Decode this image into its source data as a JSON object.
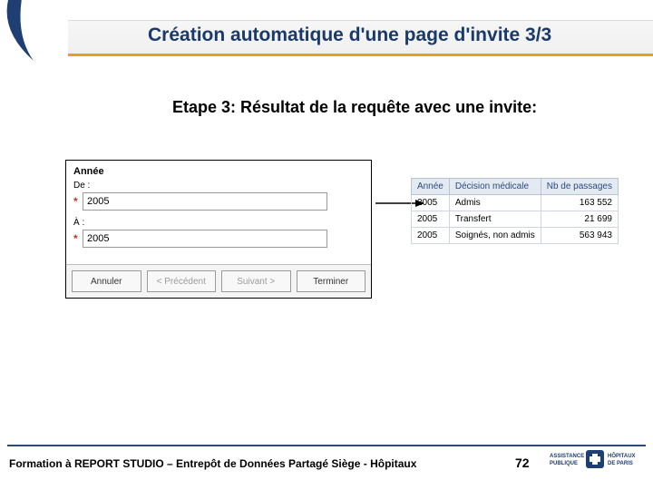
{
  "header": {
    "title": "Création automatique d'une page d'invite 3/3"
  },
  "subtitle": "Etape 3: Résultat de la requête avec une invite:",
  "prompt": {
    "field_label": "Année",
    "from_label": "De :",
    "to_label": "À :",
    "required_marker": "*",
    "from_value": "2005",
    "to_value": "2005",
    "buttons": {
      "cancel": "Annuler",
      "prev": "< Précédent",
      "next": "Suivant >",
      "finish": "Terminer"
    }
  },
  "result": {
    "headers": {
      "col1": "Année",
      "col2": "Décision médicale",
      "col3": "Nb de passages"
    },
    "rows": [
      {
        "year": "2005",
        "decision": "Admis",
        "count": "163 552"
      },
      {
        "year": "2005",
        "decision": "Transfert",
        "count": "21 699"
      },
      {
        "year": "2005",
        "decision": "Soignés, non admis",
        "count": "563 943"
      }
    ]
  },
  "footer": {
    "text": "Formation à REPORT STUDIO – Entrepôt de Données Partagé Siège - Hôpitaux",
    "page": "72",
    "logo_line1": "ASSISTANCE",
    "logo_line2": "PUBLIQUE",
    "logo_line3": "HÔPITAUX",
    "logo_line4": "DE PARIS"
  }
}
